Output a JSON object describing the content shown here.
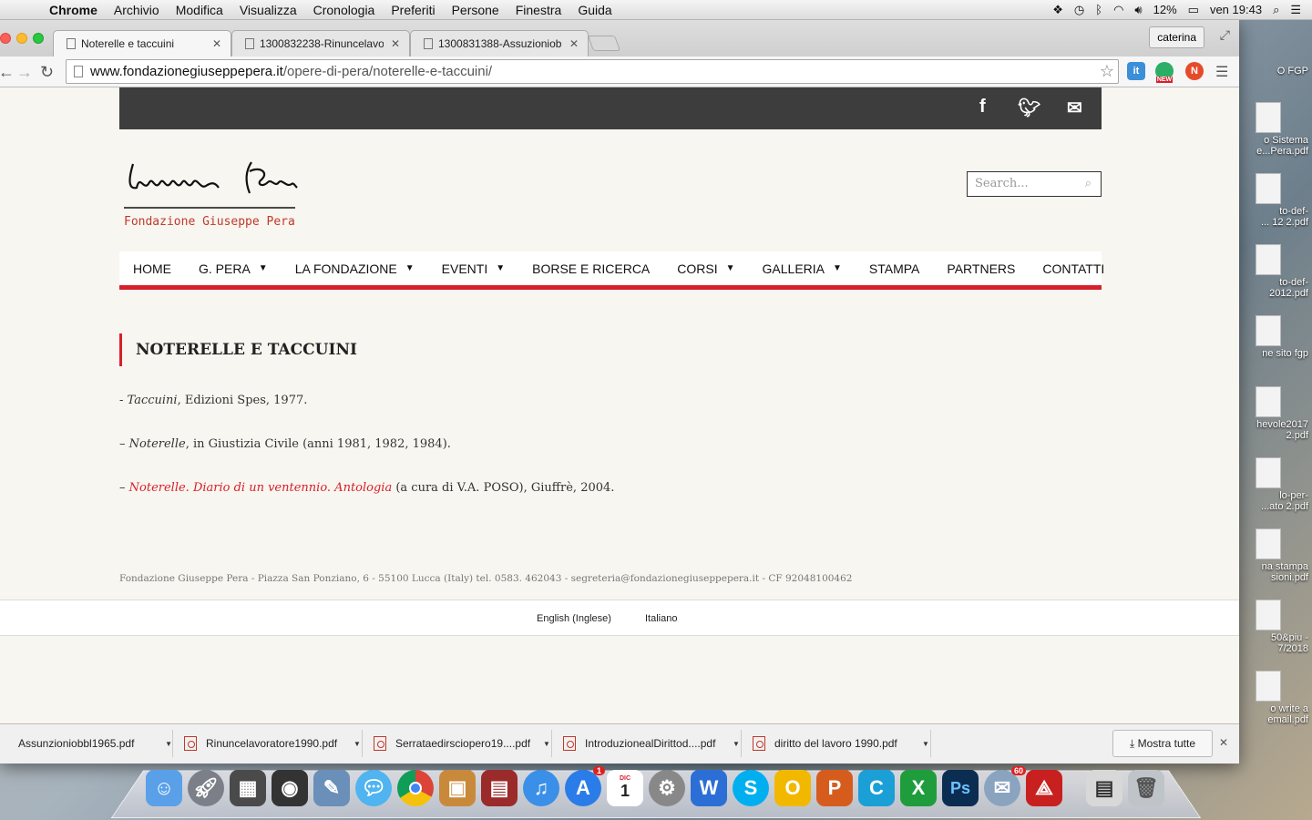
{
  "menubar": {
    "app": "Chrome",
    "items": [
      "Archivio",
      "Modifica",
      "Visualizza",
      "Cronologia",
      "Preferiti",
      "Persone",
      "Finestra",
      "Guida"
    ],
    "battery": "12%",
    "clock": "ven 19:43"
  },
  "tabs": [
    {
      "title": "Noterelle e taccuini",
      "active": true
    },
    {
      "title": "1300832238-Rinuncelavo",
      "active": false
    },
    {
      "title": "1300831388-Assuzioniob",
      "active": false
    }
  ],
  "profile": "caterina",
  "url": {
    "host": "www.fondazionegiuseppepera.it",
    "path": "/opere-di-pera/noterelle-e-taccuini/"
  },
  "extensions": {
    "new_badge": "NEW"
  },
  "site": {
    "logo_caption": "Fondazione Giuseppe Pera",
    "search_placeholder": "Search...",
    "nav": [
      {
        "label": "HOME",
        "dropdown": false
      },
      {
        "label": "G. PERA",
        "dropdown": true
      },
      {
        "label": "LA FONDAZIONE",
        "dropdown": true
      },
      {
        "label": "EVENTI",
        "dropdown": true
      },
      {
        "label": "BORSE E RICERCA",
        "dropdown": false
      },
      {
        "label": "CORSI",
        "dropdown": true
      },
      {
        "label": "GALLERIA",
        "dropdown": true
      },
      {
        "label": "STAMPA",
        "dropdown": false
      },
      {
        "label": "PARTNERS",
        "dropdown": false
      },
      {
        "label": "CONTATTI",
        "dropdown": false
      }
    ],
    "page_title": "NOTERELLE E TACCUINI",
    "entries": [
      {
        "prefix": "- ",
        "italic": "Taccuini",
        "rest": ", Edizioni Spes, 1977."
      },
      {
        "prefix": "– ",
        "italic": "Noterelle",
        "rest": ", in Giustizia Civile (anni 1981, 1982, 1984)."
      },
      {
        "prefix": "– ",
        "link": "Noterelle. Diario di un ventennio. Antologia",
        "rest": " (a cura di V.A. POSO), Giuffrè, 2004."
      }
    ],
    "footer": "Fondazione Giuseppe Pera - Piazza San Ponziano, 6 - 55100 Lucca (Italy) tel. 0583. 462043 - segreteria@fondazionegiuseppepera.it - CF 92048100462",
    "languages": [
      "English (Inglese)",
      "Italiano"
    ]
  },
  "downloads": {
    "items": [
      "Assunzioniobbl1965.pdf",
      "Rinuncelavoratore1990.pdf",
      "Serrataedirsciopero19....pdf",
      "IntroduzionealDirittod....pdf",
      "diritto del lavoro 1990.pdf"
    ],
    "show_all": "Mostra tutte"
  },
  "desktop_items": [
    {
      "label": "O FGP"
    },
    {
      "label": "o Sistema\ne...Pera.pdf"
    },
    {
      "label": "to-def-\n... 12 2.pdf"
    },
    {
      "label": "to-def-\n2012.pdf"
    },
    {
      "label": "ne sito fgp"
    },
    {
      "label": "hevole2017\n2.pdf"
    },
    {
      "label": "lo-per-\n...ato 2.pdf"
    },
    {
      "label": "na stampa\nsioni.pdf"
    },
    {
      "label": "50&piu -\n7/2018"
    },
    {
      "label": "o write a\nemail.pdf"
    }
  ],
  "dock": {
    "mail_badge": "60",
    "appstore_badge": "1",
    "calendar_day": "1",
    "calendar_month": "DIC"
  },
  "colors": {
    "accent": "#d8202a",
    "topbar": "#3d3d3d",
    "page_bg": "#f8f6f0"
  }
}
